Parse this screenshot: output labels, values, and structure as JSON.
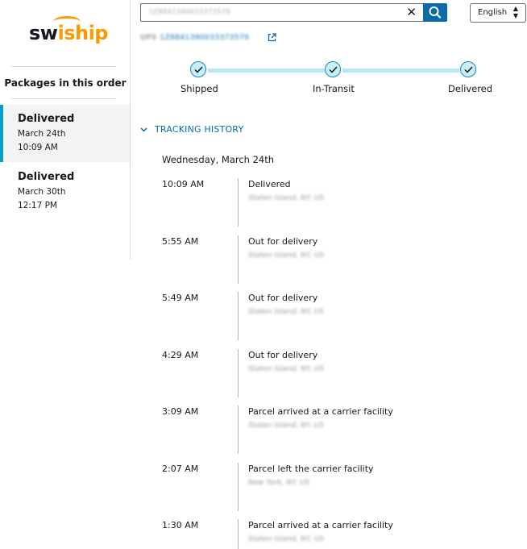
{
  "brand": {
    "logo_part1": "sw",
    "logo_part2": "iship"
  },
  "sidebar": {
    "title": "Packages in this order",
    "packages": [
      {
        "status": "Delivered",
        "date": "March 24th",
        "time": "10:09 AM",
        "selected": true
      },
      {
        "status": "Delivered",
        "date": "March 30th",
        "time": "12:17 PM",
        "selected": false
      }
    ]
  },
  "search": {
    "value": "1Z8841390033373579"
  },
  "language": {
    "selected": "English"
  },
  "tracking": {
    "carrier": "UPS",
    "number": "1Z8841390033373579"
  },
  "progress": {
    "steps": [
      "Shipped",
      "In-Transit",
      "Delivered"
    ]
  },
  "history": {
    "header": "TRACKING HISTORY",
    "date": "Wednesday, March 24th",
    "events": [
      {
        "time": "10:09 AM",
        "description": "Delivered",
        "location": "Staten Island, NY, US"
      },
      {
        "time": "5:55 AM",
        "description": "Out for delivery",
        "location": "Staten Island, NY, US"
      },
      {
        "time": "5:49 AM",
        "description": "Out for delivery",
        "location": "Staten Island, NY, US"
      },
      {
        "time": "4:29 AM",
        "description": "Out for delivery",
        "location": "Staten Island, NY, US"
      },
      {
        "time": "3:09 AM",
        "description": "Parcel arrived at a carrier facility",
        "location": "Staten Island, NY, US"
      },
      {
        "time": "2:07 AM",
        "description": "Parcel left the carrier facility",
        "location": "New York, NY, US"
      },
      {
        "time": "1:30 AM",
        "description": "Parcel arrived at a carrier facility",
        "location": "Staten Island, NY, US"
      }
    ]
  },
  "colors": {
    "accent": "#0a6ba8",
    "brand_orange": "#ff9900",
    "progress": "#b3e8f4",
    "selected_bar": "#0a9dc6"
  },
  "icons": [
    "clear-icon",
    "search-icon",
    "sort-arrows-icon",
    "external-link-icon",
    "check-icon",
    "chevron-down-icon"
  ]
}
